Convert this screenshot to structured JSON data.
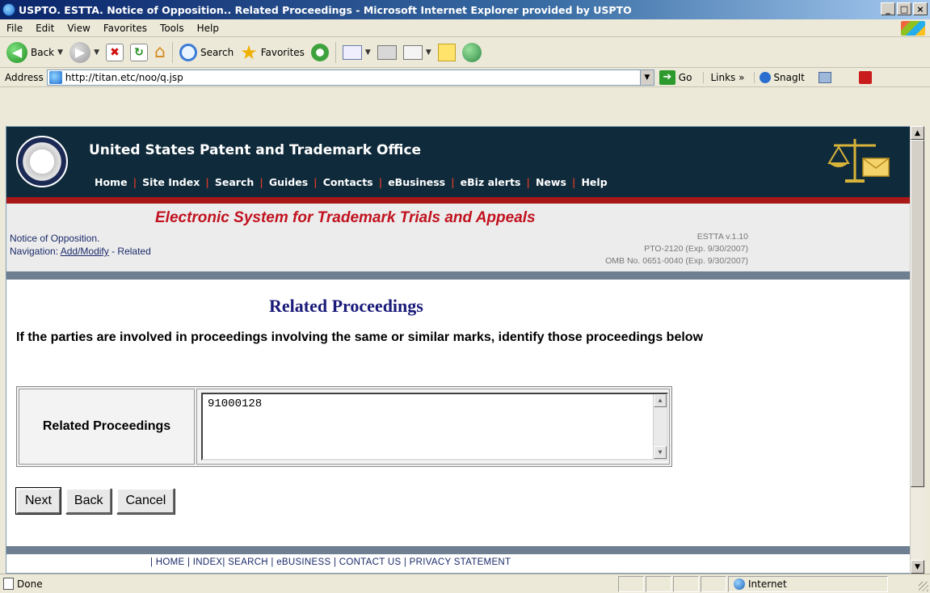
{
  "window": {
    "title": "USPTO. ESTTA. Notice of Opposition.. Related Proceedings - Microsoft Internet Explorer provided by USPTO",
    "controls": [
      "_",
      "□",
      "×"
    ]
  },
  "menu": {
    "items": [
      "File",
      "Edit",
      "View",
      "Favorites",
      "Tools",
      "Help"
    ]
  },
  "toolbar": {
    "back_label": "Back",
    "search_label": "Search",
    "favorites_label": "Favorites"
  },
  "address": {
    "label": "Address",
    "url": "http://titan.etc/noo/q.jsp",
    "go_label": "Go",
    "links_label": "Links",
    "links_chevron": "»",
    "snagit_label": "SnagIt"
  },
  "site": {
    "org_name": "United States Patent and Trademark Office",
    "nav": [
      "Home",
      "Site Index",
      "Search",
      "Guides",
      "Contacts",
      "eBusiness",
      "eBiz alerts",
      "News",
      "Help"
    ],
    "estta_title": "Electronic System for Trademark Trials and Appeals",
    "notice": "Notice of Opposition.",
    "navigation_prefix": "Navigation: ",
    "navigation_link": "Add/Modify",
    "navigation_suffix": " - Related",
    "version_lines": [
      "ESTTA v.1.10",
      "PTO-2120 (Exp. 9/30/2007)",
      "OMB No. 0651-0040 (Exp. 9/30/2007)"
    ]
  },
  "page": {
    "heading": "Related Proceedings",
    "instruction": "If the parties are involved in proceedings involving the same or similar marks, identify those proceedings below",
    "field_label": "Related Proceedings",
    "field_value": "91000128",
    "buttons": {
      "next": "Next",
      "back": "Back",
      "cancel": "Cancel"
    },
    "footer_links": "| HOME | INDEX| SEARCH | eBUSINESS | CONTACT US | PRIVACY STATEMENT"
  },
  "status": {
    "text": "Done",
    "zone": "Internet"
  },
  "colors": {
    "header_bg": "#0f2a3a",
    "red_rule": "#a81818",
    "estta_title": "#c1121f",
    "heading": "#1a1a7a"
  }
}
